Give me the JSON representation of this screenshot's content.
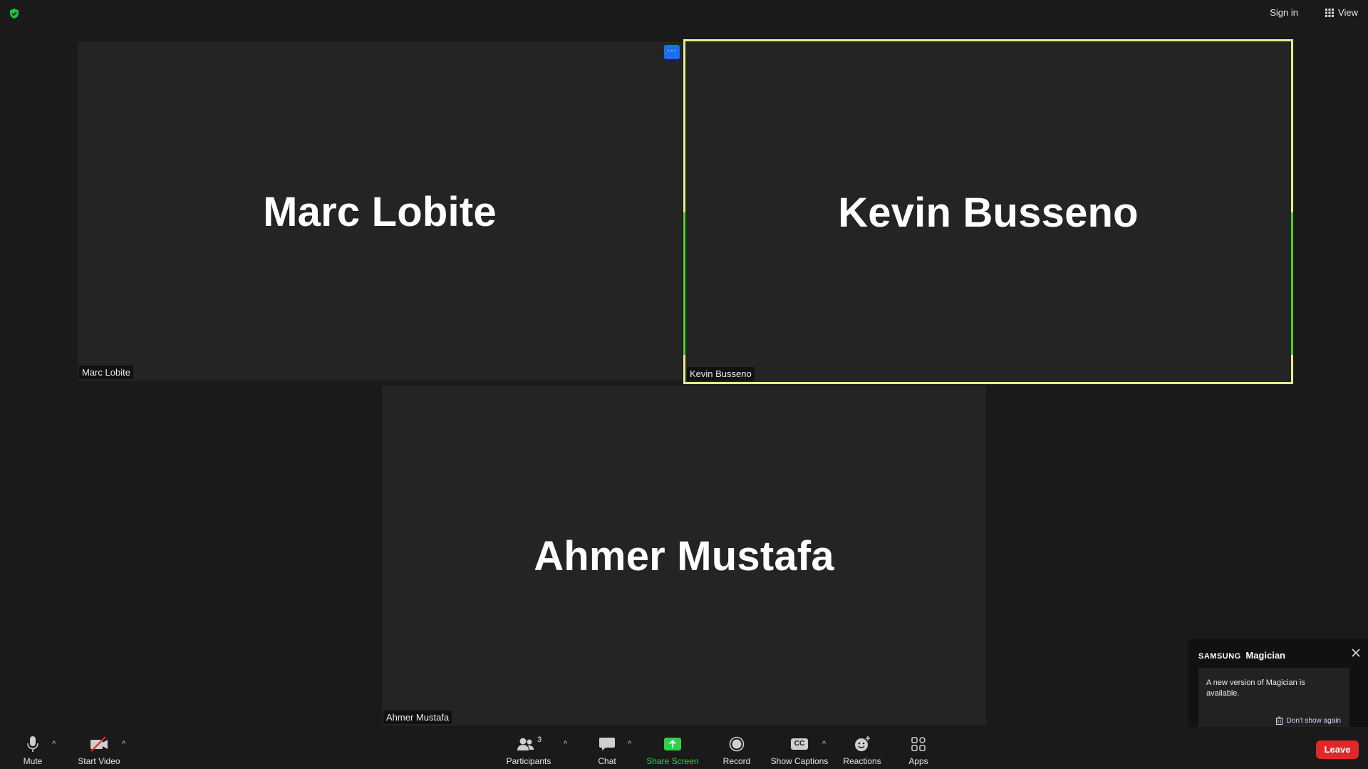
{
  "topbar": {
    "security_icon": "shield-check-icon",
    "sign_in": "Sign in",
    "view_label": "View",
    "view_icon": "grid-icon"
  },
  "participants": [
    {
      "display_name": "Marc Lobite",
      "nameplate": "Marc Lobite"
    },
    {
      "display_name": "Kevin Busseno",
      "nameplate": "Kevin Busseno",
      "active_speaker": true
    },
    {
      "display_name": "Ahmer Mustafa",
      "nameplate": "Ahmer Mustafa"
    }
  ],
  "tile_menu": {
    "label": "···"
  },
  "toolbar": {
    "mute": {
      "label": "Mute",
      "icon": "microphone-icon"
    },
    "start_video": {
      "label": "Start Video",
      "icon": "video-off-icon"
    },
    "participants": {
      "label": "Participants",
      "count": "3",
      "icon": "participants-icon"
    },
    "chat": {
      "label": "Chat",
      "icon": "chat-icon"
    },
    "share_screen": {
      "label": "Share Screen",
      "icon": "share-screen-icon"
    },
    "record": {
      "label": "Record",
      "icon": "record-icon"
    },
    "show_captions": {
      "label": "Show Captions",
      "icon": "cc-icon",
      "icon_text": "CC"
    },
    "reactions": {
      "label": "Reactions",
      "icon": "smiley-icon"
    },
    "apps": {
      "label": "Apps",
      "icon": "apps-icon"
    },
    "caret": "^"
  },
  "notification": {
    "brand": "SAMSUNG",
    "app_name": "Magician",
    "message": "A new version of Magician is available.",
    "dont_show": "Don't show again"
  },
  "leave_button": "Leave",
  "colors": {
    "active_border": "#e6ef8a",
    "share_green": "#2fd14a",
    "leave_red": "#e02828",
    "menu_blue": "#1b6ff5"
  }
}
